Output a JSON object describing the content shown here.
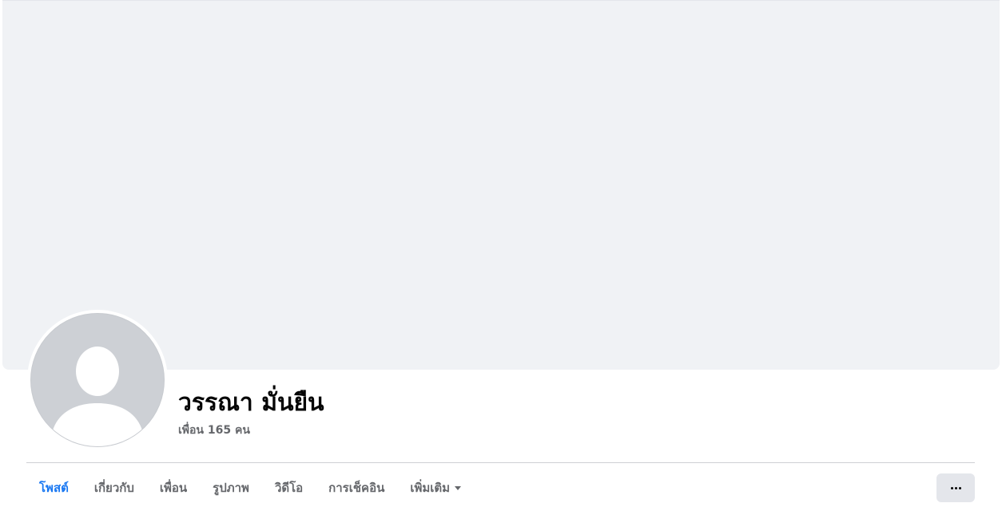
{
  "profile": {
    "name": "วรรณา มั่นยืน",
    "friends_count_label": "เพื่อน 165 คน"
  },
  "tabs": [
    {
      "label": "โพสต์",
      "active": true
    },
    {
      "label": "เกี่ยวกับ",
      "active": false
    },
    {
      "label": "เพื่อน",
      "active": false
    },
    {
      "label": "รูปภาพ",
      "active": false
    },
    {
      "label": "วิดีโอ",
      "active": false
    },
    {
      "label": "การเช็คอิน",
      "active": false
    },
    {
      "label": "เพิ่มเติม",
      "active": false,
      "icon": "caret-down-icon"
    }
  ],
  "actions": {
    "more_icon": "more-dots-icon"
  },
  "colors": {
    "accent": "#1877f2",
    "cover_bg": "#f0f2f5",
    "secondary_text": "#65676b",
    "button_bg": "#e4e6eb"
  }
}
